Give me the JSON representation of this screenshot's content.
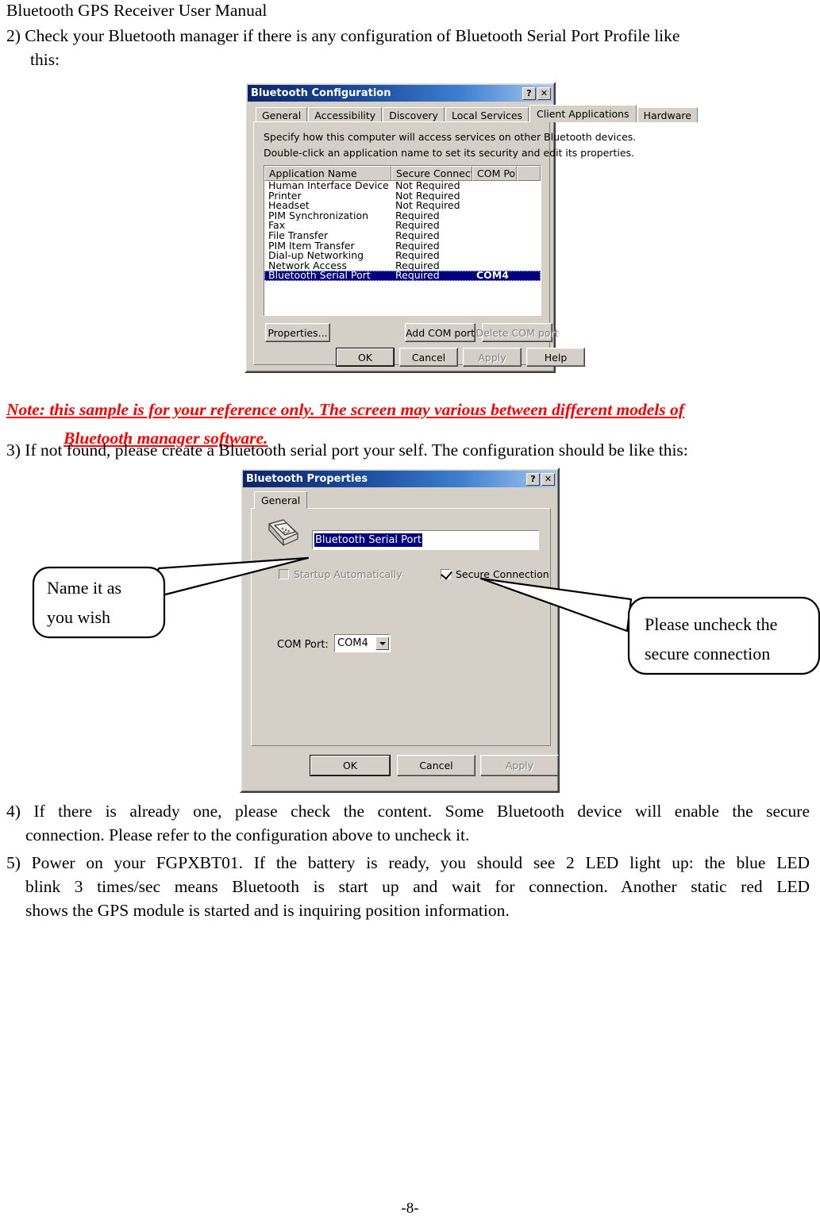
{
  "document": {
    "header": "Bluetooth GPS Receiver User Manual",
    "footer": "-8-",
    "step2": {
      "line1": "2) Check your Bluetooth manager if there is any configuration of Bluetooth Serial Port Profile like",
      "line2": "this:"
    },
    "note": {
      "line1": "Note: this sample is for your reference only. The screen may various between different models of",
      "line2": "Bluetooth manager software."
    },
    "step3": "3) If not found, please create a Bluetooth serial port your self. The configuration should be like this:",
    "step4": {
      "line1": "4) If there is already one, please check the content. Some Bluetooth device will enable the secure",
      "line2": "connection. Please refer to the configuration above to uncheck it."
    },
    "step5": {
      "line1": "5) Power on your FGPXBT01. If the battery is ready, you should see 2 LED light up: the blue LED",
      "line2": "blink 3 times/sec means Bluetooth is start up and wait for connection. Another static red LED",
      "line3": "shows the GPS module is started and is inquiring position information."
    }
  },
  "dialog_config": {
    "title": "Bluetooth Configuration",
    "help_button": "?",
    "close_button": "✕",
    "tabs": [
      {
        "label": "General",
        "active": false
      },
      {
        "label": "Accessibility",
        "active": false
      },
      {
        "label": "Discovery",
        "active": false
      },
      {
        "label": "Local Services",
        "active": false
      },
      {
        "label": "Client Applications",
        "active": true
      },
      {
        "label": "Hardware",
        "active": false
      }
    ],
    "description_line1": "Specify how this computer will access services on other Bluetooth devices.",
    "description_line2": "Double-click an application name to set its security and edit its properties.",
    "columns": [
      "Application Name",
      "Secure Connection",
      "COM Port"
    ],
    "rows": [
      {
        "name": "Human Interface Device",
        "secure": "Not Required",
        "com": "",
        "selected": false
      },
      {
        "name": "Printer",
        "secure": "Not Required",
        "com": "",
        "selected": false
      },
      {
        "name": "Headset",
        "secure": "Not Required",
        "com": "",
        "selected": false
      },
      {
        "name": "PIM Synchronization",
        "secure": "Required",
        "com": "",
        "selected": false
      },
      {
        "name": "Fax",
        "secure": "Required",
        "com": "",
        "selected": false
      },
      {
        "name": "File Transfer",
        "secure": "Required",
        "com": "",
        "selected": false
      },
      {
        "name": "PIM Item Transfer",
        "secure": "Required",
        "com": "",
        "selected": false
      },
      {
        "name": "Dial-up Networking",
        "secure": "Required",
        "com": "",
        "selected": false
      },
      {
        "name": "Network Access",
        "secure": "Required",
        "com": "",
        "selected": false
      },
      {
        "name": "Bluetooth Serial Port",
        "secure": "Required",
        "com": "COM4",
        "selected": true
      }
    ],
    "buttons": {
      "properties": "Properties...",
      "add_com_port": "Add COM port",
      "delete_com_port": "Delete COM port",
      "ok": "OK",
      "cancel": "Cancel",
      "apply": "Apply",
      "help": "Help"
    }
  },
  "dialog_properties": {
    "title": "Bluetooth Properties",
    "help_button": "?",
    "close_button": "✕",
    "tab": "General",
    "name_field_value": "Bluetooth Serial Port",
    "startup_checkbox": {
      "label": "Startup Automatically",
      "checked": false,
      "disabled": true
    },
    "secure_checkbox": {
      "label": "Secure Connection",
      "checked": true,
      "disabled": false
    },
    "com_port_label": "COM Port:",
    "com_port_value": "COM4",
    "buttons": {
      "ok": "OK",
      "cancel": "Cancel",
      "apply": "Apply"
    }
  },
  "callouts": {
    "left": {
      "line1": "Name it as",
      "line2": "you wish"
    },
    "right": {
      "line1": "Please uncheck the",
      "line2": "secure connection"
    }
  },
  "colors": {
    "note_red": "#ff0000",
    "titlebar_dark": "#0a246a",
    "titlebar_light": "#a6caf0",
    "dialog_face": "#d4d0c8",
    "selection_blue": "#000080"
  }
}
